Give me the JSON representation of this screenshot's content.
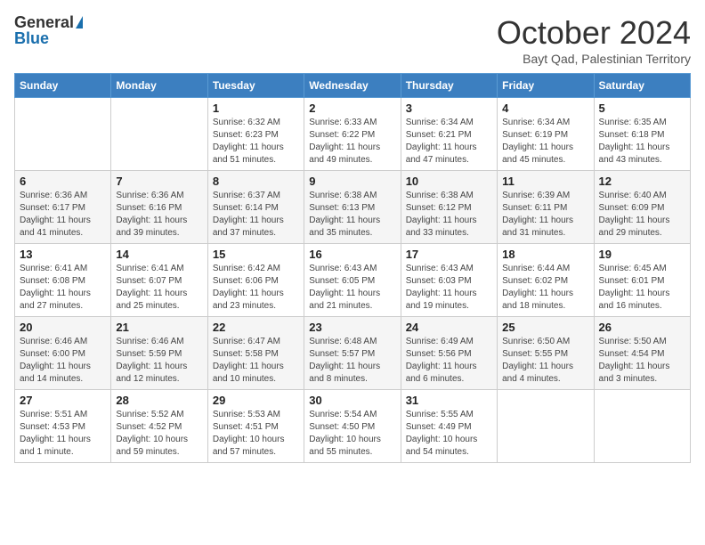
{
  "logo": {
    "general": "General",
    "blue": "Blue"
  },
  "title": "October 2024",
  "subtitle": "Bayt Qad, Palestinian Territory",
  "days_of_week": [
    "Sunday",
    "Monday",
    "Tuesday",
    "Wednesday",
    "Thursday",
    "Friday",
    "Saturday"
  ],
  "weeks": [
    [
      {
        "day": "",
        "info": ""
      },
      {
        "day": "",
        "info": ""
      },
      {
        "day": "1",
        "info": "Sunrise: 6:32 AM\nSunset: 6:23 PM\nDaylight: 11 hours and 51 minutes."
      },
      {
        "day": "2",
        "info": "Sunrise: 6:33 AM\nSunset: 6:22 PM\nDaylight: 11 hours and 49 minutes."
      },
      {
        "day": "3",
        "info": "Sunrise: 6:34 AM\nSunset: 6:21 PM\nDaylight: 11 hours and 47 minutes."
      },
      {
        "day": "4",
        "info": "Sunrise: 6:34 AM\nSunset: 6:19 PM\nDaylight: 11 hours and 45 minutes."
      },
      {
        "day": "5",
        "info": "Sunrise: 6:35 AM\nSunset: 6:18 PM\nDaylight: 11 hours and 43 minutes."
      }
    ],
    [
      {
        "day": "6",
        "info": "Sunrise: 6:36 AM\nSunset: 6:17 PM\nDaylight: 11 hours and 41 minutes."
      },
      {
        "day": "7",
        "info": "Sunrise: 6:36 AM\nSunset: 6:16 PM\nDaylight: 11 hours and 39 minutes."
      },
      {
        "day": "8",
        "info": "Sunrise: 6:37 AM\nSunset: 6:14 PM\nDaylight: 11 hours and 37 minutes."
      },
      {
        "day": "9",
        "info": "Sunrise: 6:38 AM\nSunset: 6:13 PM\nDaylight: 11 hours and 35 minutes."
      },
      {
        "day": "10",
        "info": "Sunrise: 6:38 AM\nSunset: 6:12 PM\nDaylight: 11 hours and 33 minutes."
      },
      {
        "day": "11",
        "info": "Sunrise: 6:39 AM\nSunset: 6:11 PM\nDaylight: 11 hours and 31 minutes."
      },
      {
        "day": "12",
        "info": "Sunrise: 6:40 AM\nSunset: 6:09 PM\nDaylight: 11 hours and 29 minutes."
      }
    ],
    [
      {
        "day": "13",
        "info": "Sunrise: 6:41 AM\nSunset: 6:08 PM\nDaylight: 11 hours and 27 minutes."
      },
      {
        "day": "14",
        "info": "Sunrise: 6:41 AM\nSunset: 6:07 PM\nDaylight: 11 hours and 25 minutes."
      },
      {
        "day": "15",
        "info": "Sunrise: 6:42 AM\nSunset: 6:06 PM\nDaylight: 11 hours and 23 minutes."
      },
      {
        "day": "16",
        "info": "Sunrise: 6:43 AM\nSunset: 6:05 PM\nDaylight: 11 hours and 21 minutes."
      },
      {
        "day": "17",
        "info": "Sunrise: 6:43 AM\nSunset: 6:03 PM\nDaylight: 11 hours and 19 minutes."
      },
      {
        "day": "18",
        "info": "Sunrise: 6:44 AM\nSunset: 6:02 PM\nDaylight: 11 hours and 18 minutes."
      },
      {
        "day": "19",
        "info": "Sunrise: 6:45 AM\nSunset: 6:01 PM\nDaylight: 11 hours and 16 minutes."
      }
    ],
    [
      {
        "day": "20",
        "info": "Sunrise: 6:46 AM\nSunset: 6:00 PM\nDaylight: 11 hours and 14 minutes."
      },
      {
        "day": "21",
        "info": "Sunrise: 6:46 AM\nSunset: 5:59 PM\nDaylight: 11 hours and 12 minutes."
      },
      {
        "day": "22",
        "info": "Sunrise: 6:47 AM\nSunset: 5:58 PM\nDaylight: 11 hours and 10 minutes."
      },
      {
        "day": "23",
        "info": "Sunrise: 6:48 AM\nSunset: 5:57 PM\nDaylight: 11 hours and 8 minutes."
      },
      {
        "day": "24",
        "info": "Sunrise: 6:49 AM\nSunset: 5:56 PM\nDaylight: 11 hours and 6 minutes."
      },
      {
        "day": "25",
        "info": "Sunrise: 6:50 AM\nSunset: 5:55 PM\nDaylight: 11 hours and 4 minutes."
      },
      {
        "day": "26",
        "info": "Sunrise: 5:50 AM\nSunset: 4:54 PM\nDaylight: 11 hours and 3 minutes."
      }
    ],
    [
      {
        "day": "27",
        "info": "Sunrise: 5:51 AM\nSunset: 4:53 PM\nDaylight: 11 hours and 1 minute."
      },
      {
        "day": "28",
        "info": "Sunrise: 5:52 AM\nSunset: 4:52 PM\nDaylight: 10 hours and 59 minutes."
      },
      {
        "day": "29",
        "info": "Sunrise: 5:53 AM\nSunset: 4:51 PM\nDaylight: 10 hours and 57 minutes."
      },
      {
        "day": "30",
        "info": "Sunrise: 5:54 AM\nSunset: 4:50 PM\nDaylight: 10 hours and 55 minutes."
      },
      {
        "day": "31",
        "info": "Sunrise: 5:55 AM\nSunset: 4:49 PM\nDaylight: 10 hours and 54 minutes."
      },
      {
        "day": "",
        "info": ""
      },
      {
        "day": "",
        "info": ""
      }
    ]
  ]
}
